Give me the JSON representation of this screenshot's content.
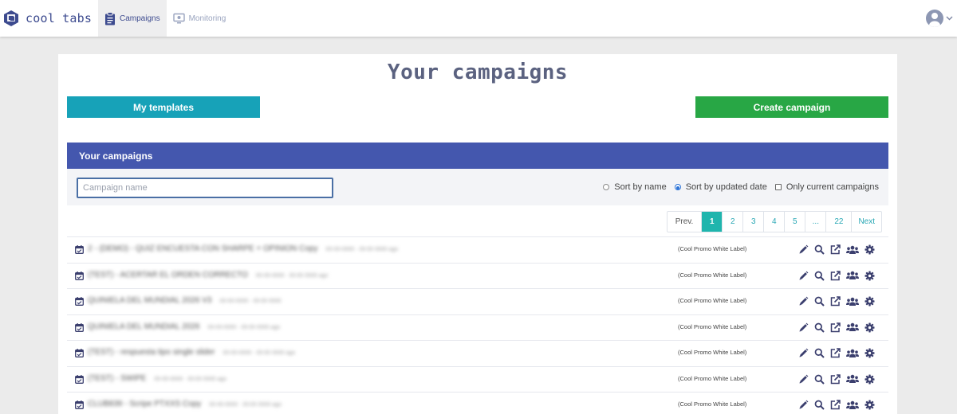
{
  "app": {
    "brand": "cool tabs"
  },
  "nav": {
    "tabs": [
      {
        "label": "Campaigns",
        "active": true
      },
      {
        "label": "Monitoring",
        "active": false
      }
    ]
  },
  "page": {
    "title": "Your campaigns"
  },
  "buttons": {
    "templates": "My templates",
    "create": "Create campaign"
  },
  "panel": {
    "title": "Your campaigns",
    "search_placeholder": "Campaign name",
    "sort_by_name": "Sort by name",
    "sort_by_date": "Sort by updated date",
    "only_current": "Only current campaigns"
  },
  "pagination": {
    "prev": "Prev.",
    "pages": [
      "1",
      "2",
      "3",
      "4",
      "5",
      "...",
      "22"
    ],
    "next": "Next",
    "current": "1"
  },
  "campaigns": [
    {
      "name": "2 - (DEMO) - QUIZ ENCUESTA CON SHARPE + OPINION Copy",
      "meta": "00-00-0000 · 00:00 0000 ago",
      "label": "(Cool Promo White Label)"
    },
    {
      "name": "(TEST) - ACERTAR EL ORDEN CORRECTO",
      "meta": "00-00-0000 · 00:00 0000 ago",
      "label": "(Cool Promo White Label)"
    },
    {
      "name": "QUINIELA DEL MUNDIAL 2026 V3",
      "meta": "00-00-0000 · 00:00 0000",
      "label": "(Cool Promo White Label)"
    },
    {
      "name": "QUINIELA DEL MUNDIAL 2026",
      "meta": "00-00-0000 · 00:00 0000 ago",
      "label": "(Cool Promo White Label)"
    },
    {
      "name": "(TEST) - respuesta tipo single slider",
      "meta": "00-00-0000 · 00:00 0000 ago",
      "label": "(Cool Promo White Label)"
    },
    {
      "name": "(TEST) - SWIPE",
      "meta": "00-00-0000 · 00:00 0000 ago",
      "label": "(Cool Promo White Label)"
    },
    {
      "name": "CLUB839 - Scripe PTXXS Copy",
      "meta": "00-00-0000 · 00:00 0000 ago",
      "label": "(Cool Promo White Label)"
    }
  ],
  "colors": {
    "brand": "#3d4b8f",
    "panel_header": "#4457ae",
    "templates_button": "#17a2b8",
    "create_button": "#28a745",
    "pager_active": "#1fb5ad",
    "action_icons": "#3b3f6e"
  },
  "icons": {
    "brand": "hexagon-logo-icon",
    "campaigns_tab": "clipboard-icon",
    "monitoring_tab": "monitor-icon",
    "user": "user-avatar-icon",
    "row": [
      "calendar-check-icon",
      "pencil-icon",
      "search-icon",
      "external-link-icon",
      "users-icon",
      "gear-icon"
    ]
  }
}
